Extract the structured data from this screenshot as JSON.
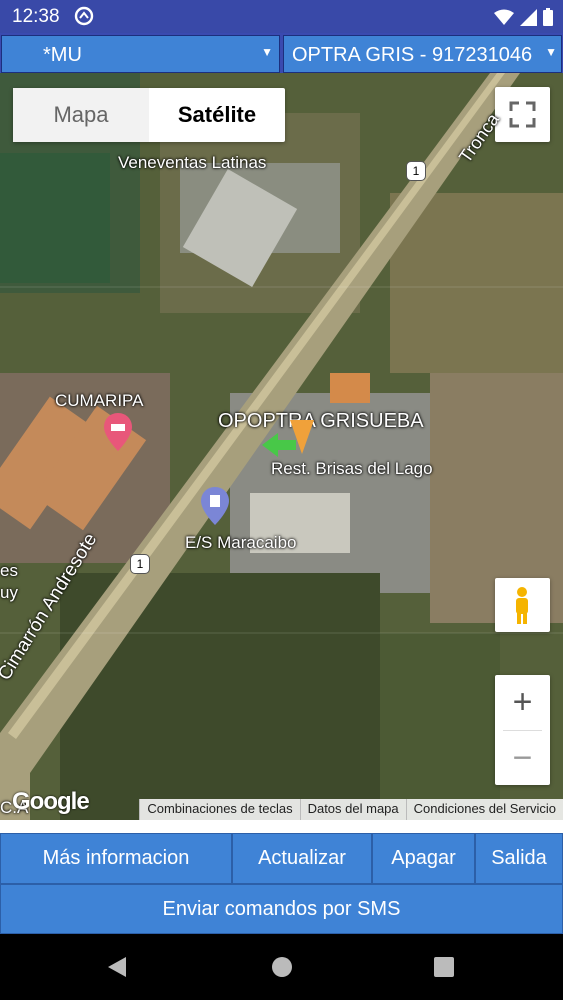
{
  "status": {
    "time": "12:38"
  },
  "spinners": {
    "left_value": "*MU",
    "right_value": "OPTRA GRIS - 917231046"
  },
  "map": {
    "type_map": "Mapa",
    "type_satellite": "Satélite",
    "places": {
      "veneventas": "Veneventas Latinas",
      "cumaripa": "CUMARIPA",
      "rest": "Rest. Brisas del Lago",
      "es": "E/S Maracaibo",
      "marker_overlap": "OPOPTRA GRISUEBA",
      "road_left": "Cimarrón Andresote",
      "road_top": "Tronca",
      "road_badge": "1",
      "edge_1": "es",
      "edge_2": "uy",
      "edge_3": "C.A"
    },
    "google": "Google",
    "attribution": [
      "Combinaciones de teclas",
      "Datos del mapa",
      "Condiciones del Servicio"
    ],
    "zoom_in": "+",
    "zoom_out": "−"
  },
  "buttons": {
    "more_info": "Más informacion",
    "update": "Actualizar",
    "off": "Apagar",
    "exit": "Salida",
    "sms": "Enviar comandos por SMS"
  },
  "colors": {
    "status_bar": "#3949a8",
    "button": "#3f83d6"
  }
}
